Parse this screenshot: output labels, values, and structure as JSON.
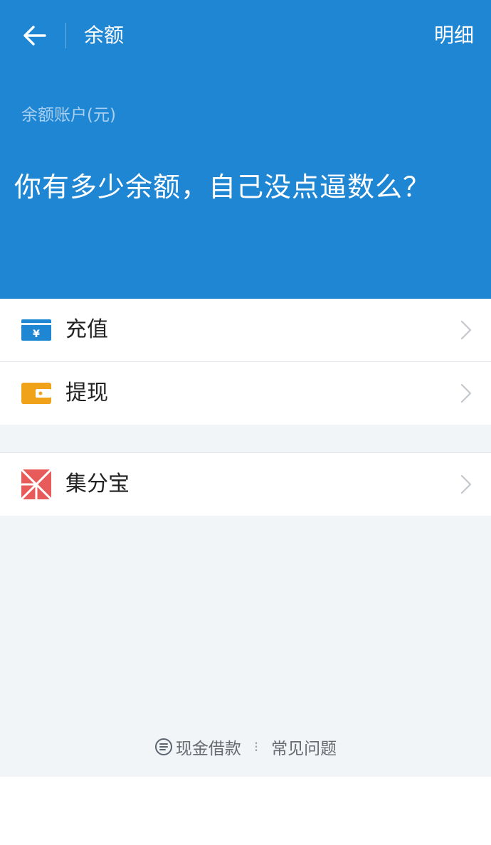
{
  "header": {
    "title": "余额",
    "detail_link": "明细",
    "background": "#1f86d4"
  },
  "balance": {
    "label": "余额账户(元)",
    "value": "你有多少余额，自己没点逼数么？"
  },
  "menu": {
    "group1": [
      {
        "label": "充值",
        "icon": "recharge-card-icon",
        "icon_color": "#1f86d4"
      },
      {
        "label": "提现",
        "icon": "wallet-icon",
        "icon_color": "#f0a21b"
      }
    ],
    "group2": [
      {
        "label": "集分宝",
        "icon": "jifenbao-icon",
        "icon_color": "#e85b5b"
      }
    ]
  },
  "footer": {
    "link1": "现金借款",
    "separator": "⁝",
    "link2": "常见问题"
  }
}
